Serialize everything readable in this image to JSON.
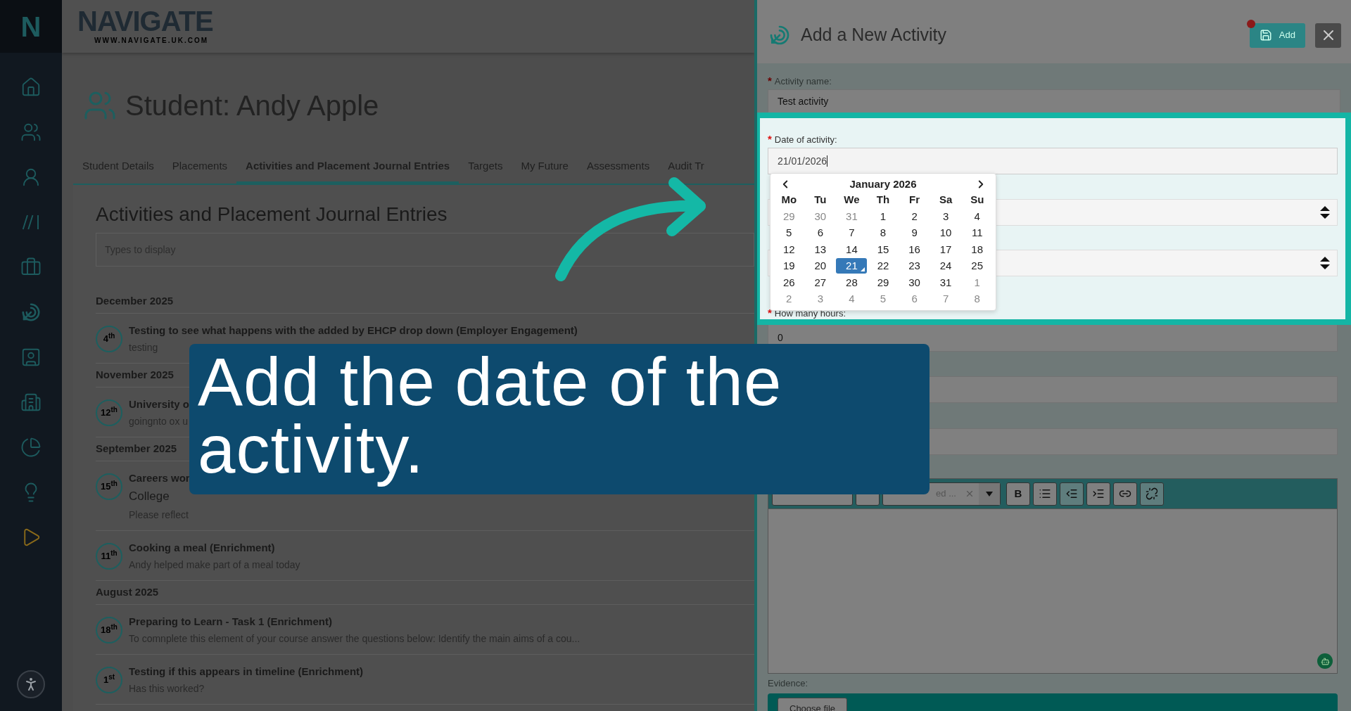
{
  "sidebar": {
    "logo": "N"
  },
  "header": {
    "logo": "NAVIGATE",
    "logo_url": "WWW.NAVIGATE.UK.COM"
  },
  "page": {
    "title": "Student: Andy Apple"
  },
  "tabs": [
    {
      "label": "Student Details",
      "selected": false
    },
    {
      "label": "Placements",
      "selected": false
    },
    {
      "label": "Activities and Placement Journal Entries",
      "selected": true
    },
    {
      "label": "Targets",
      "selected": false
    },
    {
      "label": "My Future",
      "selected": false
    },
    {
      "label": "Assessments",
      "selected": false
    },
    {
      "label": "Audit Tr",
      "selected": false
    }
  ],
  "section": {
    "title": "Activities and Placement Journal Entries",
    "filter": {
      "placeholder": "Types to display"
    },
    "groups": [
      {
        "month": "December 2025",
        "entries": [
          {
            "day": "4$^{th}$",
            "title": "Testing to see what happens with the added by EHCP drop down (Employer Engagement)",
            "note": "testing"
          }
        ]
      },
      {
        "month": "November 2025",
        "entries": [
          {
            "day": "12$^{th}$",
            "title": "University o",
            "note": "goingnto ox u"
          }
        ]
      },
      {
        "month": "September 2025",
        "entries": [
          {
            "day": "15$^{th}$",
            "title": "Careers wor",
            "detail": "College",
            "note": "Please reflect"
          },
          {
            "day": "11$^{th}$",
            "title": "Cooking a meal (Enrichment)",
            "note": "Andy helped make part of a meal today"
          }
        ]
      },
      {
        "month": "August 2025",
        "entries": [
          {
            "day": "18$^{th}$",
            "title": "Preparing to Learn - Task 1 (Enrichment)",
            "note": "To comnplete this element of your course answer the questions below: Identify the main aims of a cou..."
          },
          {
            "day": "1$^{st}$",
            "title": "Testing if this appears in timeline (Enrichment)",
            "note": "Has this worked?"
          }
        ]
      }
    ]
  },
  "panel": {
    "title": "Add a New Activity",
    "add_button": "Add",
    "activity_name": {
      "required_mark": "*",
      "label": "Activity name:",
      "value": "Test activity"
    },
    "date": {
      "required_mark": "*",
      "label": "Date of activity:",
      "value": "21/01/2026"
    },
    "hours": {
      "required_mark": "*",
      "label": "How many hours:",
      "value": "0"
    },
    "calendar": {
      "month": "January 2026",
      "weekdays": [
        "Mo",
        "Tu",
        "We",
        "Th",
        "Fr",
        "Sa",
        "Su"
      ],
      "weeks": [
        [
          {
            "day": "29",
            "other_month": true,
            "selected": false
          },
          {
            "day": "30",
            "other_month": true,
            "selected": false
          },
          {
            "day": "31",
            "other_month": true,
            "selected": false
          },
          {
            "day": "1",
            "other_month": false,
            "selected": false
          },
          {
            "day": "2",
            "other_month": false,
            "selected": false
          },
          {
            "day": "3",
            "other_month": false,
            "selected": false
          },
          {
            "day": "4",
            "other_month": false,
            "selected": false
          }
        ],
        [
          {
            "day": "5",
            "other_month": false,
            "selected": false
          },
          {
            "day": "6",
            "other_month": false,
            "selected": false
          },
          {
            "day": "7",
            "other_month": false,
            "selected": false
          },
          {
            "day": "8",
            "other_month": false,
            "selected": false
          },
          {
            "day": "9",
            "other_month": false,
            "selected": false
          },
          {
            "day": "10",
            "other_month": false,
            "selected": false
          },
          {
            "day": "11",
            "other_month": false,
            "selected": false
          }
        ],
        [
          {
            "day": "12",
            "other_month": false,
            "selected": false
          },
          {
            "day": "13",
            "other_month": false,
            "selected": false
          },
          {
            "day": "14",
            "other_month": false,
            "selected": false
          },
          {
            "day": "15",
            "other_month": false,
            "selected": false
          },
          {
            "day": "16",
            "other_month": false,
            "selected": false
          },
          {
            "day": "17",
            "other_month": false,
            "selected": false
          },
          {
            "day": "18",
            "other_month": false,
            "selected": false
          }
        ],
        [
          {
            "day": "19",
            "other_month": false,
            "selected": false
          },
          {
            "day": "20",
            "other_month": false,
            "selected": false
          },
          {
            "day": "21",
            "other_month": false,
            "selected": true
          },
          {
            "day": "22",
            "other_month": false,
            "selected": false
          },
          {
            "day": "23",
            "other_month": false,
            "selected": false
          },
          {
            "day": "24",
            "other_month": false,
            "selected": false
          },
          {
            "day": "25",
            "other_month": false,
            "selected": false
          }
        ],
        [
          {
            "day": "26",
            "other_month": false,
            "selected": false
          },
          {
            "day": "27",
            "other_month": false,
            "selected": false
          },
          {
            "day": "28",
            "other_month": false,
            "selected": false
          },
          {
            "day": "29",
            "other_month": false,
            "selected": false
          },
          {
            "day": "30",
            "other_month": false,
            "selected": false
          },
          {
            "day": "31",
            "other_month": false,
            "selected": false
          },
          {
            "day": "1",
            "other_month": true,
            "selected": false
          }
        ],
        [
          {
            "day": "2",
            "other_month": true,
            "selected": false
          },
          {
            "day": "3",
            "other_month": true,
            "selected": false
          },
          {
            "day": "4",
            "other_month": true,
            "selected": false
          },
          {
            "day": "5",
            "other_month": true,
            "selected": false
          },
          {
            "day": "6",
            "other_month": true,
            "selected": false
          },
          {
            "day": "7",
            "other_month": true,
            "selected": false
          },
          {
            "day": "8",
            "other_month": true,
            "selected": false
          }
        ]
      ]
    },
    "editor": {
      "style_value": "ed ...",
      "tools": [
        {
          "kind": "bold",
          "label": "B",
          "disabled": false
        },
        {
          "kind": "bullets",
          "disabled": false
        },
        {
          "kind": "outdent",
          "disabled": true
        },
        {
          "kind": "indent",
          "disabled": false
        },
        {
          "kind": "link",
          "disabled": false
        },
        {
          "kind": "unlink",
          "disabled": true
        }
      ]
    },
    "evidence": {
      "label": "Evidence:",
      "button": "Choose file"
    }
  },
  "caption": {
    "text": "Add the date of the activity."
  }
}
